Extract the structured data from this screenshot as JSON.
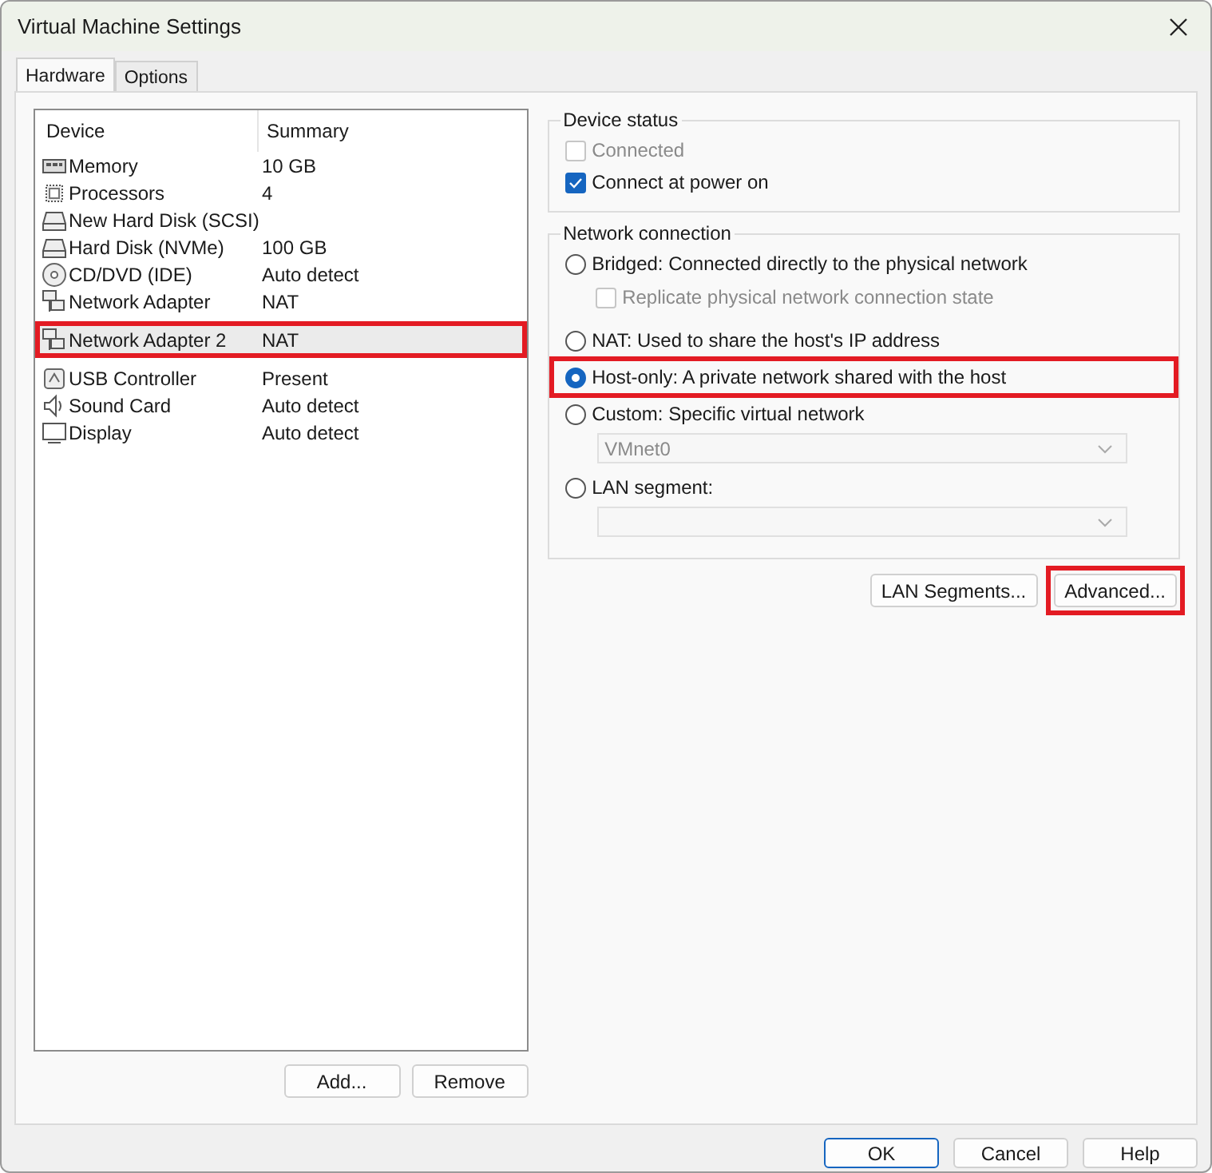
{
  "window": {
    "title": "Virtual Machine Settings"
  },
  "tabs": [
    {
      "label": "Hardware",
      "selected": true
    },
    {
      "label": "Options",
      "selected": false
    }
  ],
  "device_list": {
    "columns": [
      "Device",
      "Summary"
    ],
    "rows": [
      {
        "kind": "memory",
        "device": "Memory",
        "summary": "10 GB",
        "selected": false,
        "highlighted": false
      },
      {
        "kind": "cpu",
        "device": "Processors",
        "summary": "4",
        "selected": false,
        "highlighted": false
      },
      {
        "kind": "disk",
        "device": "New Hard Disk (SCSI)",
        "selected": false,
        "highlighted": false
      },
      {
        "kind": "disk",
        "device": "Hard Disk (NVMe)",
        "summary": "100 GB",
        "selected": false,
        "highlighted": false
      },
      {
        "kind": "cdrom",
        "device": "CD/DVD (IDE)",
        "summary": "Auto detect",
        "selected": false,
        "highlighted": false
      },
      {
        "kind": "network",
        "device": "Network Adapter",
        "summary": "NAT",
        "selected": false,
        "highlighted": false
      },
      {
        "kind": "network",
        "device": "Network Adapter 2",
        "summary": "NAT",
        "selected": true,
        "highlighted": true
      },
      {
        "kind": "usb",
        "device": "USB Controller",
        "summary": "Present",
        "selected": false,
        "highlighted": false
      },
      {
        "kind": "sound",
        "device": "Sound Card",
        "summary": "Auto detect",
        "selected": false,
        "highlighted": false
      },
      {
        "kind": "display",
        "device": "Display",
        "summary": "Auto detect",
        "selected": false,
        "highlighted": false
      }
    ]
  },
  "list_buttons": [
    "Add...",
    "Remove"
  ],
  "device_status": {
    "title": "Device status",
    "options": [
      {
        "label": "Connected",
        "checked": false,
        "disabled": true
      },
      {
        "label": "Connect at power on",
        "checked": true,
        "disabled": false
      }
    ]
  },
  "network_connection": {
    "title": "Network connection",
    "items": [
      {
        "kind": "radio",
        "label": "Bridged: Connected directly to the physical network",
        "selected": false,
        "highlighted": false
      },
      {
        "kind": "checkbox",
        "label": "Replicate physical network connection state",
        "checked": false,
        "disabled": true
      },
      {
        "kind": "radio",
        "label": "NAT: Used to share the host's IP address",
        "selected": false,
        "highlighted": false
      },
      {
        "kind": "radio",
        "label": "Host-only: A private network shared with the host",
        "selected": true,
        "highlighted": true
      },
      {
        "kind": "radio",
        "label": "Custom: Specific virtual network",
        "selected": false,
        "highlighted": false
      },
      {
        "kind": "dropdown",
        "value": "VMnet0",
        "disabled": true
      },
      {
        "kind": "radio",
        "label": "LAN segment:",
        "selected": false,
        "highlighted": false
      },
      {
        "kind": "dropdown",
        "disabled": true
      }
    ]
  },
  "panel_buttons": [
    {
      "label": "LAN Segments...",
      "highlighted": false
    },
    {
      "label": "Advanced...",
      "highlighted": true
    }
  ],
  "footer_buttons": [
    {
      "label": "OK",
      "default": true
    },
    {
      "label": "Cancel",
      "default": false
    },
    {
      "label": "Help",
      "default": false
    }
  ]
}
